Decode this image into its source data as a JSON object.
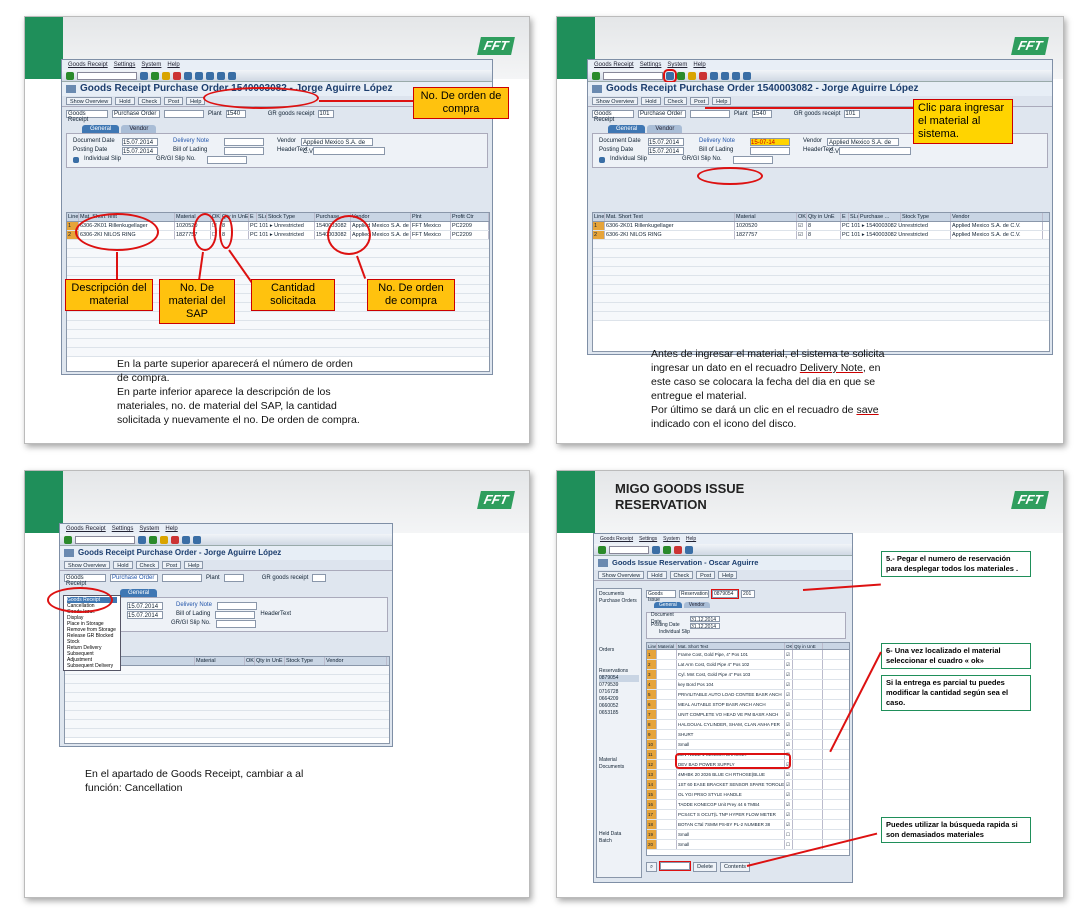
{
  "brand": {
    "logo_text": "FFT",
    "colors": {
      "green": "#1f8f5a",
      "accent_red": "#d11111",
      "callout_fill": "#ffc20e",
      "sap_blue": "#1c3e6e"
    }
  },
  "slide1": {
    "menu": [
      "Goods Receipt",
      "Settings",
      "System",
      "Help"
    ],
    "window_title": "Goods Receipt Purchase Order 1540003082 - Jorge Aguirre López",
    "app_buttons": [
      "Show Overview",
      "Hold",
      "Check",
      "Post",
      "Help"
    ],
    "hdr": {
      "action": "Goods Receipt",
      "ref": "Purchase Order",
      "plant_label": "Plant",
      "plant": "1540",
      "gr_label": "GR goods receipt",
      "gr": "101"
    },
    "tabs": [
      "General",
      "Vendor"
    ],
    "form": {
      "doc_date_label": "Document Date",
      "doc_date": "15.07.2014",
      "post_date_label": "Posting Date",
      "post_date": "15.07.2014",
      "slip": "Individual Slip",
      "delivery_label": "Delivery Note",
      "bol_label": "Bill of Lading",
      "grgi_label": "GR/GI Slip No.",
      "vendor_label": "Vendor",
      "vendor": "Applied Mexico S.A. de C.V.",
      "header_label": "HeaderText"
    },
    "grid_head": [
      "Line",
      "Mat. Short Text",
      "Material",
      "OK",
      "Qty in UnE",
      "E",
      "SLoc",
      "Stock Type",
      "Purchase...",
      "Vendor",
      "Plnt",
      "Profit Ctr"
    ],
    "rows": [
      {
        "line": "1",
        "text": "6306-2K01 Rillenkugellager",
        "material": "1020520",
        "qty": "8",
        "stock": "PC 101 ▸ Unrestricted",
        "po": "1540003082",
        "vendor": "Applied Mexico S.A. de C.V.",
        "plant": "FFT Mexico",
        "pc": "PC2209"
      },
      {
        "line": "2",
        "text": "6306-2KI NILOS RING",
        "material": "1827757",
        "qty": "8",
        "stock": "PC 101 ▸ Unrestricted",
        "po": "1540003082",
        "vendor": "Applied Mexico S.A. de C.V.",
        "plant": "FFT Mexico",
        "pc": "PC2209"
      }
    ],
    "callouts": {
      "po": "No. De orden de compra",
      "desc": "Descripción del material",
      "sap_mat": "No. De material del SAP",
      "qty": "Cantidad solicitada",
      "po2": "No. De orden de compra"
    },
    "caption": "En la parte superior aparecerá el número de orden de compra.\nEn parte inferior aparece la descripción de los materiales, no. de material del SAP, la cantidad solicitada y nuevamente el no. De orden de compra."
  },
  "slide2": {
    "window_title": "Goods Receipt Purchase Order 1540003082 - Jorge Aguirre López",
    "delivery_value": "15-07-14",
    "grid_head": [
      "Line",
      "Mat. Short Text",
      "Material",
      "OK",
      "Qty in UnE",
      "E",
      "SLoc",
      "Purchase ...",
      "Stock Type",
      "Vendor"
    ],
    "rows": [
      {
        "line": "1",
        "text": "6306-2K01 Rillenkugellager",
        "material": "1020520",
        "qty": "8",
        "stock": "PC 101 ▸ 1540003082 Unrestricted",
        "vendor": "Applied Mexico S.A. de C.V."
      },
      {
        "line": "2",
        "text": "6306-2KI NILOS RING",
        "material": "1827757",
        "qty": "8",
        "stock": "PC 101 ▸ 1540003082 Unrestricted",
        "vendor": "Applied Mexico S.A. de C.V."
      }
    ],
    "callout": "Clic para ingresar el material al sistema.",
    "caption_parts": {
      "p1": "Antes de ingresar el material, el sistema te solicita ingresar un dato en el recuadro ",
      "link": "Delivery Note",
      "p2": ", en este caso se colocara la fecha del dia en que se entregue el material.",
      "p3": "Por último se dará un clic en el recuadro de ",
      "save": "save",
      "p4": " indicado con el icono del disco."
    }
  },
  "slide3": {
    "window_title": "Goods Receipt Purchase Order - Jorge Aguirre López",
    "menu_items": [
      "Goods Receipt",
      "Cancellation",
      "Goods Issue",
      "Display",
      "Place in Storage",
      "Remove from Storage",
      "Release GR Blocked Stock",
      "Return Delivery",
      "Subsequent Adjustment",
      "Subsequent Delivery"
    ],
    "selected_action": "Goods Receipt",
    "caption": "En el apartado de Goods Receipt, cambiar a al función: Cancellation"
  },
  "slide4": {
    "title": "MIGO GOODS ISSUE RESERVATION",
    "window_title": "Goods Issue Reservation - Oscar Aguirre",
    "hdr": {
      "action": "Goods Issue",
      "ref": "Reservation",
      "res_no": "0879054",
      "gi": "201"
    },
    "doc_date": "31.12.2014",
    "post_date": "31.12.2014",
    "tree": [
      "Documents",
      "Purchase Orders",
      "Orders",
      "Reservations",
      "0879054",
      "0779539",
      "0716728",
      "0664209",
      "0660052",
      "0653185",
      "Material Documents",
      "Held Data",
      "Batch"
    ],
    "rows": [
      "Frame Cost, Gold Pipe, 4” Pos 101",
      "Lat Arm Cost, Gold Pipe 4” Pos 102",
      "Cyl. Mnt Cost, Gold Pipe 4” Pos 103",
      "key Bord Pos 104",
      "PRIVILITABLE AUTO LOAD CONTEE BASR ANCH",
      "MEAL AUTABLE STOP BASR ANCH ANCH",
      "UNIT COMPLETE VO HEAD VE PM BASR ANCH",
      "HALGOUAL CYLINDER, SHAM, CLAN ANHA FER",
      "SHURT",
      "Small",
      "BEV NUBE 1 SENSOR BRACKET",
      "DEV BAD POWER SUPPLY",
      "4MHBK 20 2026 BLUE CH RTHOSE(BLUE",
      "1ST 60 EASE BRACKET SENSOR SPARE TOROLE",
      "OL YGI PRSO STYLE HANDLE",
      "TADDE KONECGP Unit Prey 44 6 TMB4",
      "PCS4CT S OCUT(L TNP HYPER FLOW METER",
      "BOTAN CTal 7SMM PS-BY PL-2 NUMBER 38",
      "Small",
      "Small"
    ],
    "ok_flags": [
      "☑",
      "☑",
      "☑",
      "☑",
      "☑",
      "☑",
      "☑",
      "☑",
      "☑",
      "☑",
      "☑",
      "☑",
      "☑",
      "☑",
      "☑",
      "☑",
      "☑",
      "☑",
      "☐",
      "☐"
    ],
    "box1": "5.- Pegar el numero de reservación para desplegar todos los materiales .",
    "box2": "6- Una vez localizado el material seleccionar el cuadro « ok»",
    "box3": "Si la entrega es parcial tu puedes modificar la cantidad según sea el caso.",
    "box4": "Puedes utilizar la búsqueda rapida si son demasiados materiales",
    "bottom_buttons": [
      "Delete",
      "Contents"
    ]
  }
}
